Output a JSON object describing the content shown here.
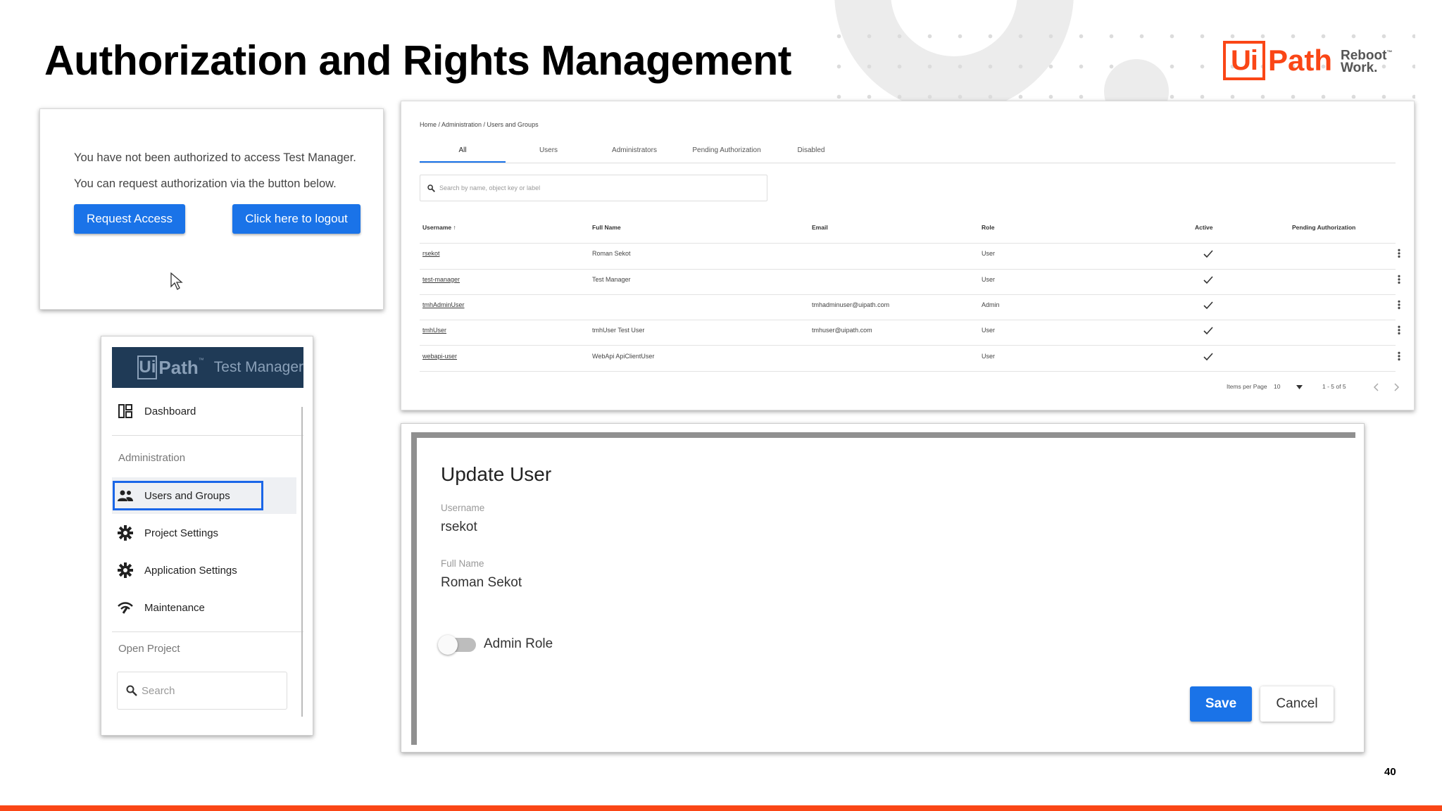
{
  "slide": {
    "title": "Authorization and Rights Management",
    "page_number": "40",
    "logo": {
      "mark": "Ui",
      "word": "Path",
      "tagline_1": "Reboot",
      "tagline_2": "Work.",
      "tm": "™"
    }
  },
  "auth_card": {
    "message_1": "You have not been authorized to access Test Manager.",
    "message_2": "You can request authorization via the button below.",
    "request_button": "Request Access",
    "logout_button": "Click here to logout"
  },
  "nav": {
    "logo_mark": "Ui",
    "logo_word": "Path",
    "logo_tm": "™",
    "app_name": "Test Manager",
    "items": [
      {
        "label": "Dashboard",
        "icon": "dashboard-icon"
      },
      {
        "label": "Users and Groups",
        "icon": "people-icon"
      },
      {
        "label": "Project Settings",
        "icon": "gear-icon"
      },
      {
        "label": "Application Settings",
        "icon": "gear-icon"
      },
      {
        "label": "Maintenance",
        "icon": "maintenance-icon"
      }
    ],
    "section_admin": "Administration",
    "section_open_project": "Open Project",
    "search_placeholder": "Search"
  },
  "users_table": {
    "breadcrumb": "Home / Administration / Users and Groups",
    "tabs": [
      "All",
      "Users",
      "Administrators",
      "Pending Authorization",
      "Disabled"
    ],
    "active_tab": "All",
    "search_placeholder": "Search by name, object key or label",
    "columns": [
      "Username",
      "Full Name",
      "Email",
      "Role",
      "Active",
      "Pending Authorization"
    ],
    "rows": [
      {
        "username": "rsekot",
        "full_name": "Roman Sekot",
        "email": "",
        "role": "User",
        "active": true
      },
      {
        "username": "test-manager",
        "full_name": "Test Manager",
        "email": "",
        "role": "User",
        "active": true
      },
      {
        "username": "tmhAdminUser",
        "full_name": "",
        "email": "tmhadminuser@uipath.com",
        "role": "Admin",
        "active": true
      },
      {
        "username": "tmhUser",
        "full_name": "tmhUser Test User",
        "email": "tmhuser@uipath.com",
        "role": "User",
        "active": true
      },
      {
        "username": "webapi-user",
        "full_name": "WebApi ApiClientUser",
        "email": "",
        "role": "User",
        "active": true
      }
    ],
    "items_per_page_label": "Items per Page",
    "items_per_page": "10",
    "range": "1 - 5 of 5"
  },
  "update_user": {
    "title": "Update User",
    "username_label": "Username",
    "username": "rsekot",
    "fullname_label": "Full Name",
    "fullname": "Roman Sekot",
    "admin_role_label": "Admin Role",
    "admin_role_on": false,
    "save_button": "Save",
    "cancel_button": "Cancel"
  },
  "colors": {
    "brand": "#fa4616",
    "primary_button": "#1a73e8",
    "nav_header": "#1f3a56"
  }
}
